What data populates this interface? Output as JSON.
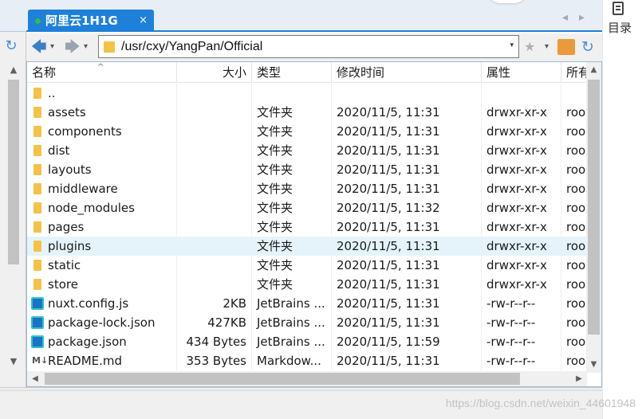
{
  "tab": {
    "title": "阿里云1H1G",
    "close": "×",
    "nav": "◂▸"
  },
  "toolbar": {
    "back_icon": "🡄",
    "forward_icon": "🡆",
    "dropdown_glyph": "▾",
    "path": "/usr/cxy/YangPan/Official",
    "star_icon": "★",
    "refresh_icon": "↻"
  },
  "columns": {
    "name": "名称",
    "size": "大小",
    "type": "类型",
    "modified": "修改时间",
    "attributes": "属性",
    "owner": "所有"
  },
  "files": [
    {
      "icon": "folder",
      "name": "..",
      "size": "",
      "type": "",
      "modified": "",
      "attributes": "",
      "owner": ""
    },
    {
      "icon": "folder",
      "name": "assets",
      "size": "",
      "type": "文件夹",
      "modified": "2020/11/5, 11:31",
      "attributes": "drwxr-xr-x",
      "owner": "roo"
    },
    {
      "icon": "folder",
      "name": "components",
      "size": "",
      "type": "文件夹",
      "modified": "2020/11/5, 11:31",
      "attributes": "drwxr-xr-x",
      "owner": "roo"
    },
    {
      "icon": "folder",
      "name": "dist",
      "size": "",
      "type": "文件夹",
      "modified": "2020/11/5, 11:31",
      "attributes": "drwxr-xr-x",
      "owner": "roo"
    },
    {
      "icon": "folder",
      "name": "layouts",
      "size": "",
      "type": "文件夹",
      "modified": "2020/11/5, 11:31",
      "attributes": "drwxr-xr-x",
      "owner": "roo"
    },
    {
      "icon": "folder",
      "name": "middleware",
      "size": "",
      "type": "文件夹",
      "modified": "2020/11/5, 11:31",
      "attributes": "drwxr-xr-x",
      "owner": "roo"
    },
    {
      "icon": "folder",
      "name": "node_modules",
      "size": "",
      "type": "文件夹",
      "modified": "2020/11/5, 11:32",
      "attributes": "drwxr-xr-x",
      "owner": "roo"
    },
    {
      "icon": "folder",
      "name": "pages",
      "size": "",
      "type": "文件夹",
      "modified": "2020/11/5, 11:31",
      "attributes": "drwxr-xr-x",
      "owner": "roo"
    },
    {
      "icon": "folder",
      "name": "plugins",
      "size": "",
      "type": "文件夹",
      "modified": "2020/11/5, 11:31",
      "attributes": "drwxr-xr-x",
      "owner": "roo",
      "selected": true
    },
    {
      "icon": "folder",
      "name": "static",
      "size": "",
      "type": "文件夹",
      "modified": "2020/11/5, 11:31",
      "attributes": "drwxr-xr-x",
      "owner": "roo"
    },
    {
      "icon": "folder",
      "name": "store",
      "size": "",
      "type": "文件夹",
      "modified": "2020/11/5, 11:31",
      "attributes": "drwxr-xr-x",
      "owner": "roo"
    },
    {
      "icon": "webstorm",
      "name": "nuxt.config.js",
      "size": "2KB",
      "type": "JetBrains ...",
      "modified": "2020/11/5, 11:31",
      "attributes": "-rw-r--r--",
      "owner": "roo"
    },
    {
      "icon": "webstorm",
      "name": "package-lock.json",
      "size": "427KB",
      "type": "JetBrains ...",
      "modified": "2020/11/5, 11:31",
      "attributes": "-rw-r--r--",
      "owner": "roo"
    },
    {
      "icon": "webstorm",
      "name": "package.json",
      "size": "434 Bytes",
      "type": "JetBrains ...",
      "modified": "2020/11/5, 11:59",
      "attributes": "-rw-r--r--",
      "owner": "roo"
    },
    {
      "icon": "markdown",
      "name": "README.md",
      "size": "353 Bytes",
      "type": "Markdow...",
      "modified": "2020/11/5, 11:31",
      "attributes": "-rw-r--r--",
      "owner": "roo"
    }
  ],
  "right_panel": {
    "label": "目录"
  },
  "watermark": "https://blog.csdn.net/weixin_44601948",
  "colors": {
    "accent": "#1e80d8",
    "folder": "#f2c24a",
    "selected_row": "#e5f3fb"
  }
}
